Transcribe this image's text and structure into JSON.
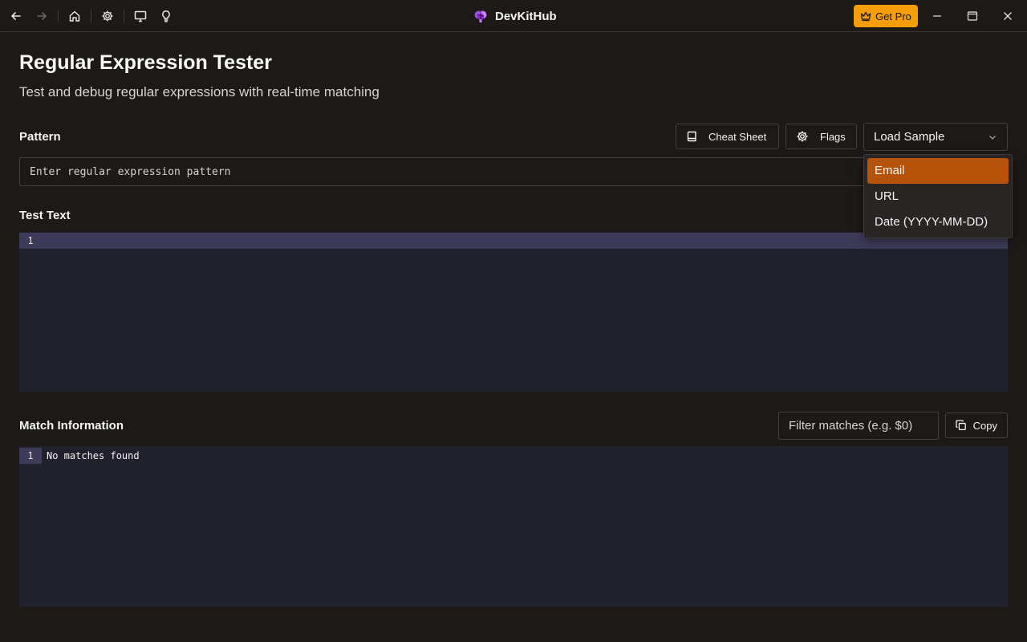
{
  "app": {
    "title": "DevKitHub",
    "get_pro_label": "Get Pro"
  },
  "titlebar": {
    "icons": [
      "arrow-left-icon",
      "arrow-right-icon",
      "home-icon",
      "gear-icon",
      "monitor-icon",
      "lightbulb-icon"
    ]
  },
  "page": {
    "title": "Regular Expression Tester",
    "subtitle": "Test and debug regular expressions with real-time matching"
  },
  "pattern": {
    "label": "Pattern",
    "placeholder": "Enter regular expression pattern",
    "value": "",
    "cheat_sheet_label": "Cheat Sheet",
    "flags_label": "Flags",
    "load_sample_label": "Load Sample",
    "samples": [
      "Email",
      "URL",
      "Date (YYYY-MM-DD)"
    ],
    "highlighted_sample": "Email"
  },
  "test_text": {
    "label": "Test Text",
    "line_number": "1"
  },
  "match_info": {
    "label": "Match Information",
    "filter_placeholder": "Filter matches (e.g. $0)",
    "copy_label": "Copy",
    "line_number": "1",
    "result_text": "No matches found"
  },
  "colors": {
    "accent": "#f59e0b",
    "selected_item": "#b45309",
    "editor_bg": "#21202d",
    "active_line": "#3d3b59"
  }
}
